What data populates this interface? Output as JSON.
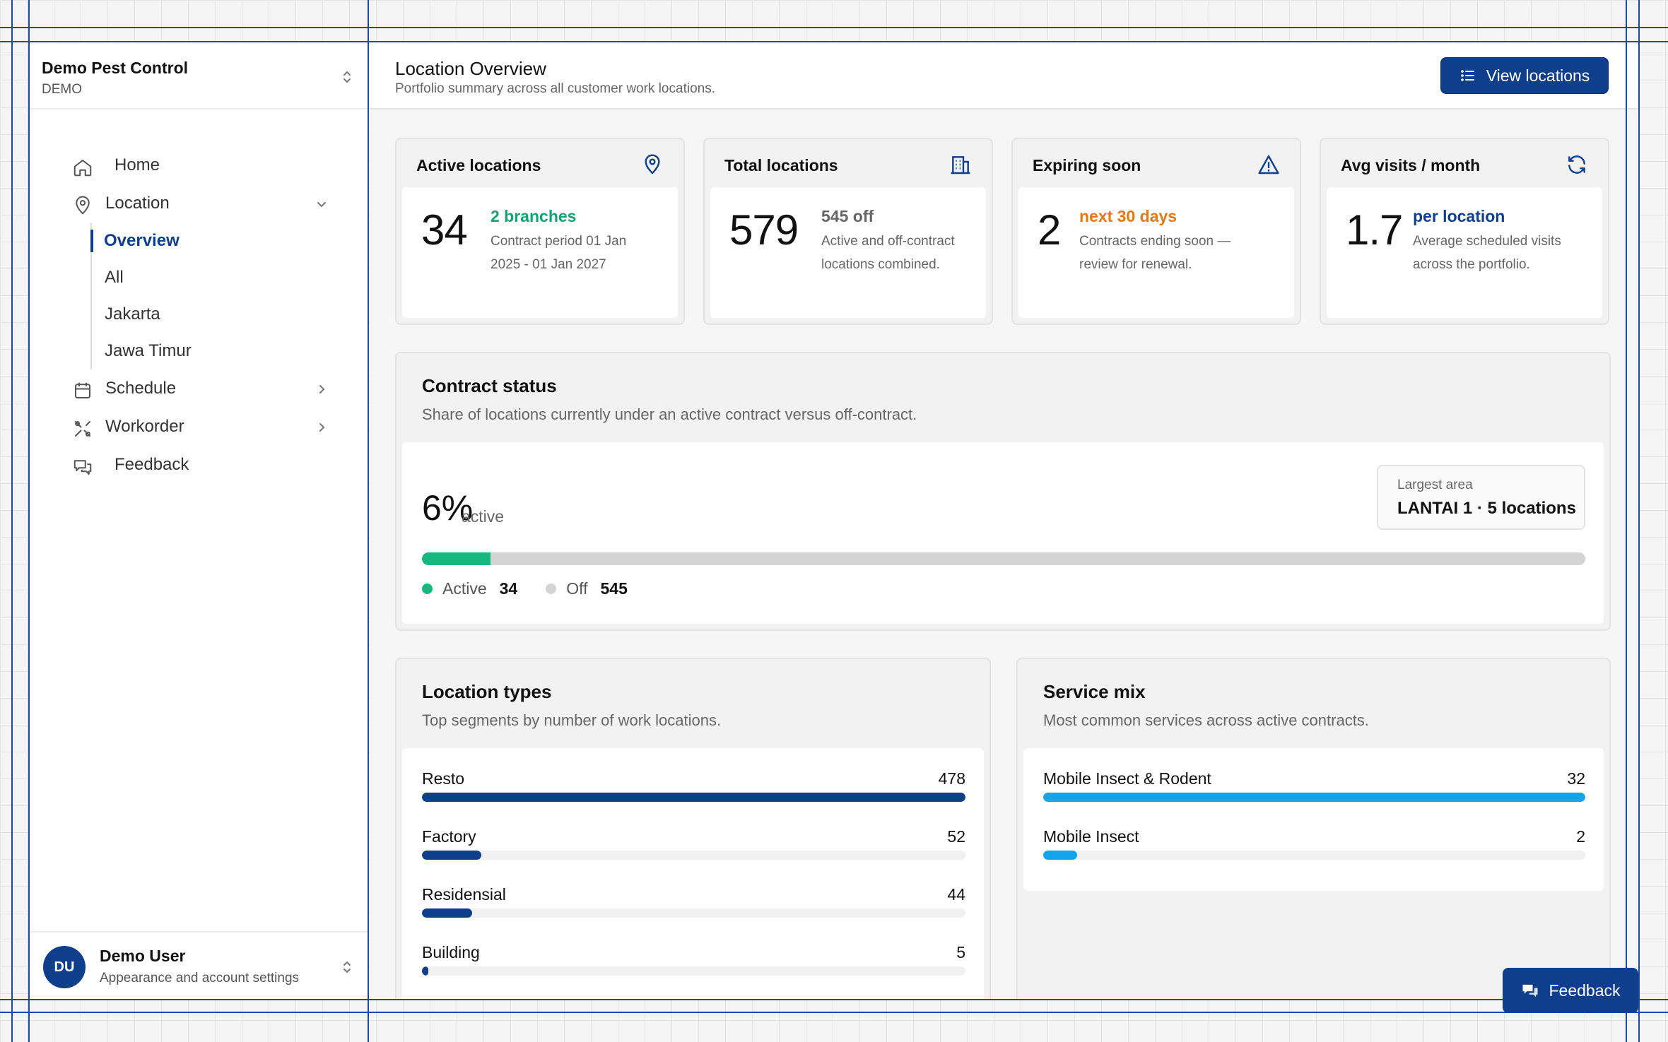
{
  "sidebar": {
    "org_name": "Demo Pest Control",
    "org_sub": "DEMO",
    "nav": {
      "home": "Home",
      "location": "Location",
      "location_sub": [
        "Overview",
        "All",
        "Jakarta",
        "Jawa Timur"
      ],
      "schedule": "Schedule",
      "workorder": "Workorder",
      "feedback": "Feedback"
    },
    "user": {
      "initials": "DU",
      "name": "Demo User",
      "sub": "Appearance and account settings"
    }
  },
  "header": {
    "title": "Location Overview",
    "subtitle": "Portfolio summary across all customer work locations.",
    "view_button": "View locations"
  },
  "stats": [
    {
      "title": "Active locations",
      "icon": "map-pin-icon",
      "value": "34",
      "highlight": "2 branches",
      "highlight_color": "#17a271",
      "desc": "Contract period 01 Jan 2025 - 01 Jan 2027"
    },
    {
      "title": "Total locations",
      "icon": "building-icon",
      "value": "579",
      "highlight": "545 off",
      "highlight_color": "#666666",
      "desc": "Active and off-contract locations combined."
    },
    {
      "title": "Expiring soon",
      "icon": "warning-icon",
      "value": "2",
      "highlight": "next 30 days",
      "highlight_color": "#e07b12",
      "desc": "Contracts ending soon — review for renewal."
    },
    {
      "title": "Avg visits / month",
      "icon": "refresh-icon",
      "value": "1.7",
      "highlight": "per location",
      "highlight_color": "#0f3f8a",
      "desc": "Average scheduled visits across the portfolio."
    }
  ],
  "contract": {
    "title": "Contract status",
    "subtitle": "Share of locations currently under an active contract versus off-contract.",
    "percent": "6%",
    "percent_label": "active",
    "active_fraction": 0.059,
    "largest_area_label": "Largest area",
    "largest_area_value": "LANTAI 1 · 5 locations",
    "legend_active_label": "Active",
    "legend_active_value": "34",
    "legend_off_label": "Off",
    "legend_off_value": "545",
    "active_color": "#17b87e",
    "off_color": "#d4d4d4"
  },
  "location_types": {
    "title": "Location types",
    "subtitle": "Top segments by number of work locations.",
    "color": "#0f3f8a",
    "items": [
      {
        "name": "Resto",
        "value": 478
      },
      {
        "name": "Factory",
        "value": 52
      },
      {
        "name": "Residensial",
        "value": 44
      },
      {
        "name": "Building",
        "value": 5
      }
    ]
  },
  "service_mix": {
    "title": "Service mix",
    "subtitle": "Most common services across active contracts.",
    "color": "#12a4ec",
    "items": [
      {
        "name": "Mobile Insect & Rodent",
        "value": 32
      },
      {
        "name": "Mobile Insect",
        "value": 2
      }
    ]
  },
  "fab": {
    "label": "Feedback"
  }
}
